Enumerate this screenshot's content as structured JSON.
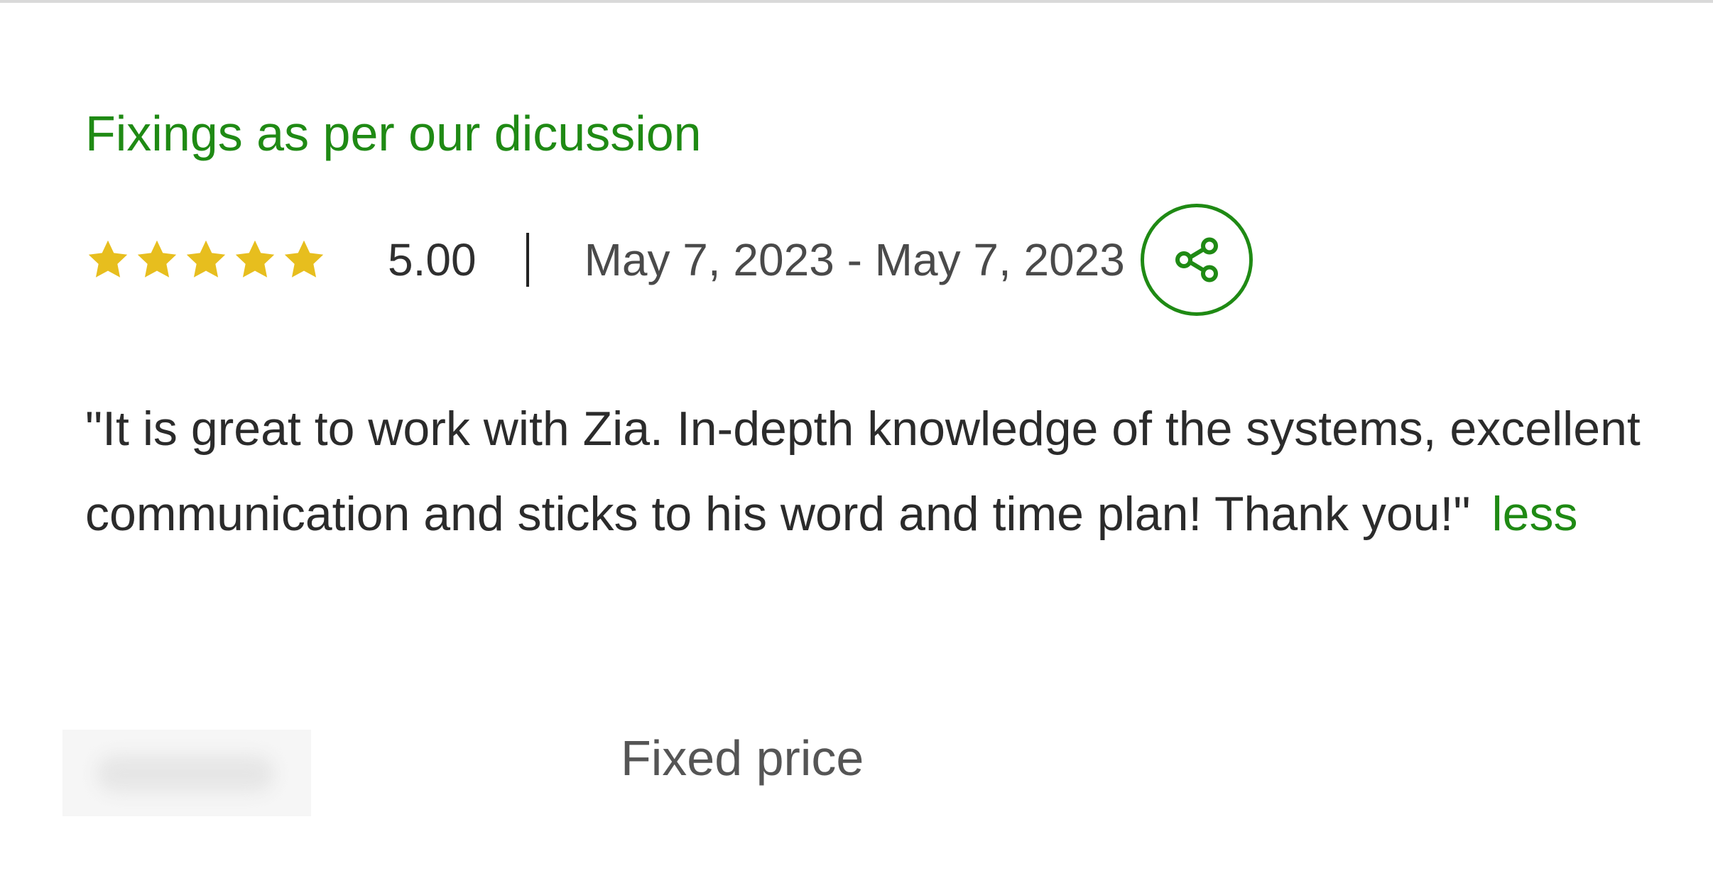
{
  "review_card": {
    "title": "Fixings as per our dicussion",
    "rating": {
      "stars_filled": 5,
      "stars_total": 5,
      "value_text": "5.00",
      "star_color": "#e7be1e"
    },
    "date_range": "May 7, 2023 - May 7, 2023",
    "share_icon": "share-icon",
    "review_text": "\"It is great to work with Zia. In-depth knowledge of the systems, excellent communication and sticks to his word and time plan! Thank you!\"",
    "less_label": "less",
    "contract_type": "Fixed price"
  },
  "colors": {
    "accent_green": "#1f8a14",
    "body_text": "#2b2b2b",
    "muted_text": "#555555"
  }
}
